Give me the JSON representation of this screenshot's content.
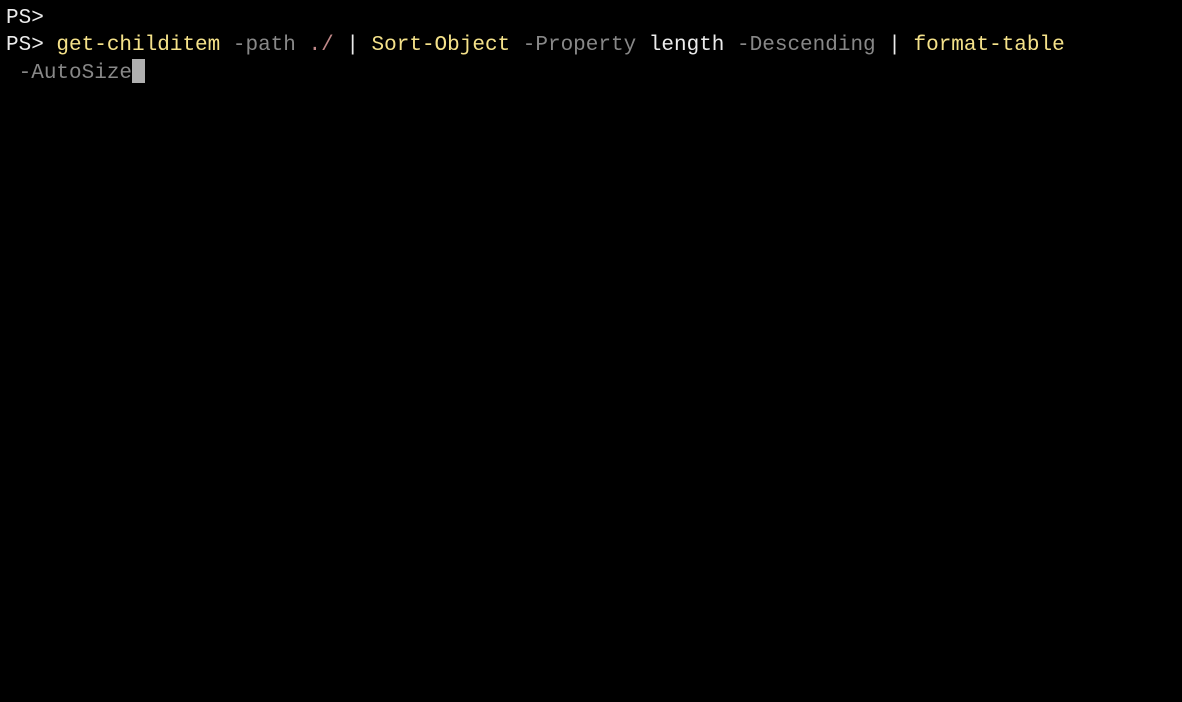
{
  "terminal": {
    "prompt": "PS>",
    "lines": [
      {
        "segments": [
          {
            "text": "PS>",
            "cls": "prompt"
          }
        ]
      },
      {
        "segments": [
          {
            "text": "PS> ",
            "cls": "prompt"
          },
          {
            "text": "get-childitem",
            "cls": "cmdlet"
          },
          {
            "text": " ",
            "cls": "argument"
          },
          {
            "text": "-path",
            "cls": "parameter"
          },
          {
            "text": " ",
            "cls": "argument"
          },
          {
            "text": "./",
            "cls": "argument-path"
          },
          {
            "text": " ",
            "cls": "argument"
          },
          {
            "text": "|",
            "cls": "pipe"
          },
          {
            "text": " ",
            "cls": "argument"
          },
          {
            "text": "Sort-Object",
            "cls": "cmdlet"
          },
          {
            "text": " ",
            "cls": "argument"
          },
          {
            "text": "-Property",
            "cls": "parameter"
          },
          {
            "text": " ",
            "cls": "argument"
          },
          {
            "text": "length",
            "cls": "argument"
          },
          {
            "text": " ",
            "cls": "argument"
          },
          {
            "text": "-Descending",
            "cls": "parameter"
          },
          {
            "text": " ",
            "cls": "argument"
          },
          {
            "text": "|",
            "cls": "pipe"
          },
          {
            "text": " ",
            "cls": "argument"
          },
          {
            "text": "format-table",
            "cls": "cmdlet"
          }
        ]
      },
      {
        "segments": [
          {
            "text": " ",
            "cls": "continuation-indent"
          },
          {
            "text": "-AutoSize",
            "cls": "parameter"
          }
        ],
        "hasCursor": true
      }
    ]
  }
}
